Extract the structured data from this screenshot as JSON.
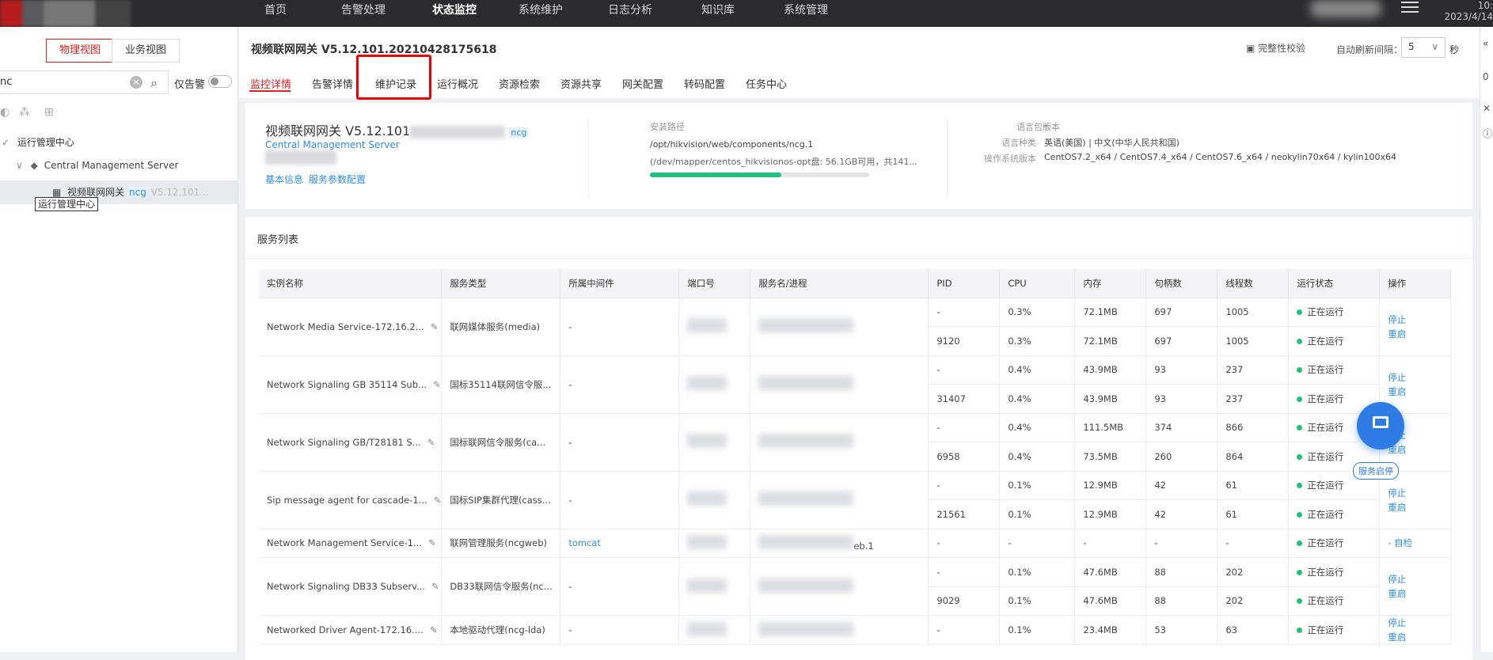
{
  "topnav": {
    "items": [
      "首页",
      "告警处理",
      "状态监控",
      "系统维护",
      "日志分析",
      "知识库",
      "系统管理"
    ],
    "active_index": 2,
    "date": "2023/4/14"
  },
  "sidebar": {
    "view_tabs": [
      "物理视图",
      "业务视图"
    ],
    "search_value": "nc",
    "alarm_only_label": "仅告警",
    "tree": {
      "root": "运行管理中心",
      "server": "Central Management Server",
      "tooltip": "运行管理中心",
      "node_name": "视频联网网关",
      "node_tag": "ncg",
      "node_version": "V5.12.101..."
    }
  },
  "main": {
    "title": "视频联网网关 V5.12.101.20210428175618",
    "integrity_check": "完整性校验",
    "auto_refresh_label": "自动刷新间隔：",
    "auto_refresh_value": "5",
    "auto_refresh_unit": "秒",
    "tabs": [
      "监控详情",
      "告警详情",
      "维护记录",
      "运行概况",
      "资源检索",
      "资源共享",
      "网关配置",
      "转码配置",
      "任务中心"
    ],
    "active_tab": "监控详情",
    "highlighted_tab": "网关配置"
  },
  "info": {
    "name": "视频联网网关 V5.12.101",
    "tag": "ncg",
    "server_link": "Central Management Server",
    "basic_info": "基本信息",
    "param_config": "服务参数配置",
    "install_path_label": "安装路径",
    "install_path": "/opt/hikvision/web/components/ncg.1",
    "disk_text": "(/dev/mapper/centos_hikvisionos-opt盘: 56.1GB可用，共141...",
    "disk_usage_fraction": 0.6,
    "lang_pack_label": "语言包版本",
    "lang_pack_value": "-",
    "lang_type_label": "语言种类",
    "lang_type_value": "英语(美国) | 中文(中华人民共和国)",
    "os_label": "操作系统版本",
    "os_value": "CentOS7.2_x64 / CentOS7.4_x64 / CentOS7.6_x64 / neokylin70x64 / kylin100x64"
  },
  "services": {
    "title": "服务列表",
    "columns": [
      "实例名称",
      "服务类型",
      "所属中间件",
      "端口号",
      "服务名/进程",
      "PID",
      "CPU",
      "内存",
      "句柄数",
      "线程数",
      "运行状态",
      "操作"
    ],
    "rows": [
      {
        "name": "Network Media Service-172.16.2...",
        "type": "联网媒体服务(media)",
        "middleware": "-",
        "sub": [
          {
            "pid": "-",
            "cpu": "0.3%",
            "mem": "72.1MB",
            "handles": "697",
            "threads": "1005",
            "status": "正在运行"
          },
          {
            "pid": "9120",
            "cpu": "0.3%",
            "mem": "72.1MB",
            "handles": "697",
            "threads": "1005",
            "status": "正在运行"
          }
        ],
        "ops": [
          "停止",
          "重启"
        ]
      },
      {
        "name": "Network Signaling GB 35114 Sub...",
        "type": "国标35114联网信令服...",
        "middleware": "-",
        "sub": [
          {
            "pid": "-",
            "cpu": "0.4%",
            "mem": "43.9MB",
            "handles": "93",
            "threads": "237",
            "status": "正在运行"
          },
          {
            "pid": "31407",
            "cpu": "0.4%",
            "mem": "43.9MB",
            "handles": "93",
            "threads": "237",
            "status": "正在运行"
          }
        ],
        "ops": [
          "停止",
          "重启"
        ]
      },
      {
        "name": "Network Signaling GB/T28181 S...",
        "type": "国标联网信令服务(ca...",
        "middleware": "-",
        "sub": [
          {
            "pid": "-",
            "cpu": "0.4%",
            "mem": "111.5MB",
            "handles": "374",
            "threads": "866",
            "status": "正在运行"
          },
          {
            "pid": "6958",
            "cpu": "0.4%",
            "mem": "73.5MB",
            "handles": "260",
            "threads": "864",
            "status": "正在运行"
          }
        ],
        "ops": [
          "停止",
          "重启"
        ]
      },
      {
        "name": "Sip message agent for cascade-1...",
        "type": "国标SIP集群代理(cass...",
        "middleware": "-",
        "sub": [
          {
            "pid": "-",
            "cpu": "0.1%",
            "mem": "12.9MB",
            "handles": "42",
            "threads": "61",
            "status": "正在运行"
          },
          {
            "pid": "21561",
            "cpu": "0.1%",
            "mem": "12.9MB",
            "handles": "42",
            "threads": "61",
            "status": "正在运行"
          }
        ],
        "ops": [
          "停止",
          "重启"
        ]
      },
      {
        "name": "Network Management Service-1...",
        "type": "联网管理服务(ncgweb)",
        "middleware": "tomcat",
        "process_suffix": "eb.1",
        "sub": [
          {
            "pid": "-",
            "cpu": "-",
            "mem": "-",
            "handles": "-",
            "threads": "-",
            "status": "正在运行"
          }
        ],
        "ops": [
          "- 自检"
        ]
      },
      {
        "name": "Network Signaling DB33 Subserv...",
        "type": "DB33联网信令服务(nc...",
        "middleware": "-",
        "sub": [
          {
            "pid": "-",
            "cpu": "0.1%",
            "mem": "47.6MB",
            "handles": "88",
            "threads": "202",
            "status": "正在运行"
          },
          {
            "pid": "9029",
            "cpu": "0.1%",
            "mem": "47.6MB",
            "handles": "88",
            "threads": "202",
            "status": "正在运行"
          }
        ],
        "ops": [
          "停止",
          "重启"
        ]
      },
      {
        "name": "Networked Driver Agent-172.16....",
        "type": "本地驱动代理(ncg-lda)",
        "middleware": "-",
        "sub": [
          {
            "pid": "-",
            "cpu": "0.1%",
            "mem": "23.4MB",
            "handles": "53",
            "threads": "63",
            "status": "正在运行"
          }
        ],
        "ops": [
          "停止",
          "重启"
        ]
      }
    ]
  },
  "fab_label": "服务启停",
  "right_strip": [
    "«",
    "0"
  ]
}
